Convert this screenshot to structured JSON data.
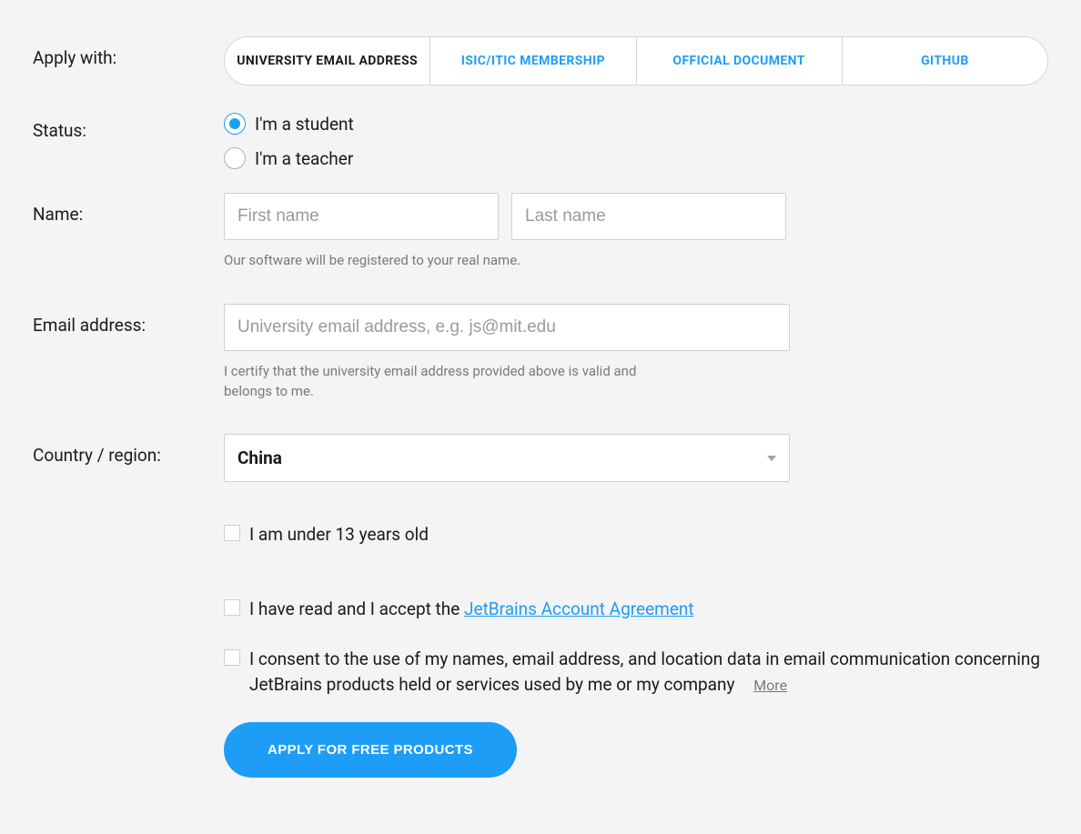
{
  "colors": {
    "accent": "#1e9df7",
    "background": "#f4f4f4",
    "text": "#1a1a1a",
    "muted": "#7a7a7a",
    "border": "#cfcfcf"
  },
  "applyWith": {
    "label": "Apply with:",
    "tabs": [
      {
        "label": "UNIVERSITY EMAIL ADDRESS",
        "active": true
      },
      {
        "label": "ISIC/ITIC MEMBERSHIP",
        "active": false
      },
      {
        "label": "OFFICIAL DOCUMENT",
        "active": false
      },
      {
        "label": "GITHUB",
        "active": false
      }
    ]
  },
  "status": {
    "label": "Status:",
    "options": [
      {
        "label": "I'm a student",
        "checked": true
      },
      {
        "label": "I'm a teacher",
        "checked": false
      }
    ]
  },
  "name": {
    "label": "Name:",
    "firstPlaceholder": "First name",
    "firstValue": "",
    "lastPlaceholder": "Last name",
    "lastValue": "",
    "helper": "Our software will be registered to your real name."
  },
  "email": {
    "label": "Email address:",
    "placeholder": "University email address, e.g. js@mit.edu",
    "value": "",
    "helper": "I certify that the university email address provided above is valid and belongs to me."
  },
  "country": {
    "label": "Country / region:",
    "selected": "China"
  },
  "checkboxes": {
    "under13": {
      "checked": false,
      "label": "I am under 13 years old"
    },
    "agreement": {
      "checked": false,
      "labelPrefix": "I have read and I accept the ",
      "linkText": "JetBrains Account Agreement"
    },
    "consent": {
      "checked": false,
      "label": "I consent to the use of my names, email address, and location data in email communication concerning JetBrains products held or services used by me or my company",
      "moreLabel": "More"
    }
  },
  "submit": {
    "label": "APPLY FOR FREE PRODUCTS"
  }
}
